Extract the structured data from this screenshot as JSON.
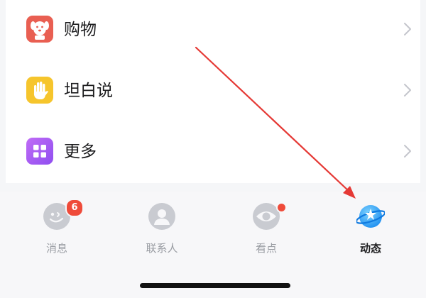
{
  "menu": {
    "items": [
      {
        "label": "购物",
        "icon": "shopping-dog-icon"
      },
      {
        "label": "坦白说",
        "icon": "hand-icon"
      },
      {
        "label": "更多",
        "icon": "grid-icon"
      }
    ]
  },
  "tabbar": {
    "tabs": [
      {
        "label": "消息",
        "icon": "messages-icon",
        "badge": "6",
        "active": false
      },
      {
        "label": "联系人",
        "icon": "contacts-icon",
        "active": false
      },
      {
        "label": "看点",
        "icon": "eye-icon",
        "has_dot": true,
        "active": false
      },
      {
        "label": "动态",
        "icon": "planet-star-icon",
        "active": true
      }
    ]
  },
  "colors": {
    "shopping": "#e95f52",
    "tanbai": "#f6c52c",
    "more": "#a45cf2",
    "badge": "#ef4b3a",
    "annotation_arrow": "#e53935"
  }
}
